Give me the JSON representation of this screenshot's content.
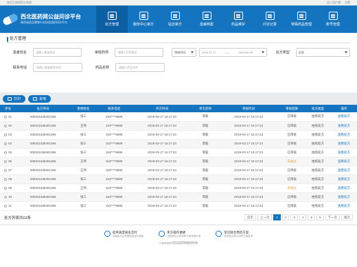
{
  "topstrip": {
    "left": "陕西互联网药诊系统",
    "login": "进入用户端",
    "settings": "设置"
  },
  "brand": {
    "title": "西北医药网公益问诊平台",
    "subtitle": "陕西省药品零售行业协会组织问诊平台"
  },
  "nav": [
    {
      "label": "处方管理",
      "icon": "prescription-icon",
      "active": true
    },
    {
      "label": "服务中心审方",
      "icon": "audit-icon"
    },
    {
      "label": "驻店审方",
      "icon": "store-icon"
    },
    {
      "label": "患病档案",
      "icon": "file-icon"
    },
    {
      "label": "药品维护",
      "icon": "drug-icon"
    },
    {
      "label": "问诊记录",
      "icon": "chat-icon"
    },
    {
      "label": "特殊药品管理",
      "icon": "special-icon"
    },
    {
      "label": "账号管理",
      "icon": "user-icon"
    }
  ],
  "section": {
    "title": "处方管理"
  },
  "filters": {
    "patient_label": "患者姓名",
    "patient_ph": "请输入患者姓名",
    "pharm_label": "审核药师",
    "pharm_ph": "请输入药师姓名",
    "time_sel": "审核时间",
    "date_start": "2018-07-17",
    "date_end": "2019-06-16",
    "rx_label": "处方类型",
    "rx_value": "全部",
    "phone_label": "联系电话",
    "phone_ph": "请输入患者联系电话",
    "drug_label": "药品名称",
    "drug_ph": "请输入药品名称"
  },
  "toolbar": {
    "print": "打印",
    "local": "本地"
  },
  "table": {
    "headers": [
      "序号",
      "处方单号",
      "患者姓名",
      "联系电话",
      "开方时间",
      "审方药师",
      "审核时间",
      "审核结果",
      "处方类型",
      "操作"
    ],
    "rows": [
      [
        "01",
        "508331638491366",
        "张三",
        "153****6889",
        "2019-03-17 16:17:23",
        "李毅",
        "2019-03-17 16:17:23",
        "已审核",
        "拍照处方",
        "查看处方"
      ],
      [
        "02",
        "508331638491366",
        "王伟",
        "153****6889",
        "2019-03-17 16:17:23",
        "李毅",
        "2019-03-17 16:17:23",
        "已审核",
        "拍照处方",
        "查看处方"
      ],
      [
        "03",
        "508331638491366",
        "张三",
        "153****6889",
        "2019-03-17 16:17:23",
        "李毅",
        "2019-03-17 16:17:23",
        "已审核",
        "拍照处方",
        "查看处方"
      ],
      [
        "04",
        "508331638491366",
        "张三",
        "153****6889",
        "2019-03-17 16:17:23",
        "李毅",
        "2019-03-17 16:17:23",
        "已审核",
        "拍照处方",
        "查看处方"
      ],
      [
        "05",
        "508331638491366",
        "张三",
        "153****6889",
        "2019-03-17 16:17:23",
        "李毅",
        "2019-03-17 16:17:23",
        "已审核",
        "拍照处方",
        "查看处方"
      ],
      [
        "06",
        "508331638491366",
        "王伟",
        "153****6889",
        "2019-03-17 16:17:23",
        "李毅",
        "2019-03-17 16:17:23",
        "未通过",
        "拍照处方",
        "查看处方"
      ],
      [
        "07",
        "508331638491366",
        "王伟",
        "153****6889",
        "2019-03-17 16:17:23",
        "李毅",
        "2019-03-17 16:17:23",
        "已审核",
        "拍照处方",
        "查看处方"
      ],
      [
        "08",
        "508331638491366",
        "张三",
        "153****6889",
        "2019-03-17 16:17:23",
        "李毅",
        "2019-03-17 16:17:23",
        "已审核",
        "拍照处方",
        "查看处方"
      ],
      [
        "09",
        "508331638491366",
        "王伟",
        "153****6889",
        "2019-03-17 16:17:23",
        "李毅",
        "2019-03-17 16:17:23",
        "未通过",
        "拍照处方",
        "查看处方"
      ],
      [
        "10",
        "508331638491366",
        "张三",
        "153****6889",
        "2019-03-17 16:17:23",
        "李毅",
        "2019-03-17 16:17:23",
        "已审核",
        "拍照处方",
        "查看处方"
      ],
      [
        "11",
        "508331638491366",
        "张三",
        "153****6889",
        "2019-03-17 16:17:23",
        "李毅",
        "2019-03-17 16:17:23",
        "已审核",
        "拍照处方",
        "查看处方"
      ]
    ]
  },
  "pagination": {
    "total": "处方列表共63条",
    "pages": [
      "首页",
      "上一页",
      "1",
      "2",
      "3",
      "4",
      "5",
      "6",
      "下一页",
      "尾页"
    ],
    "current": "1"
  },
  "features": [
    {
      "t1": "提供速度域名实时",
      "t2": "对接各平台来源信息及时更新"
    },
    {
      "t1": "审方操作便捷",
      "t2": "流程简化后药师审方更快捷方便"
    },
    {
      "t1": "常见联合用药方案",
      "t2": "提供常见联合用药方案参考"
    }
  ],
  "copyright": "Copyright©西北医药网版权所有",
  "colors": {
    "primary": "#1574bf",
    "warning": "#e8a13a"
  }
}
